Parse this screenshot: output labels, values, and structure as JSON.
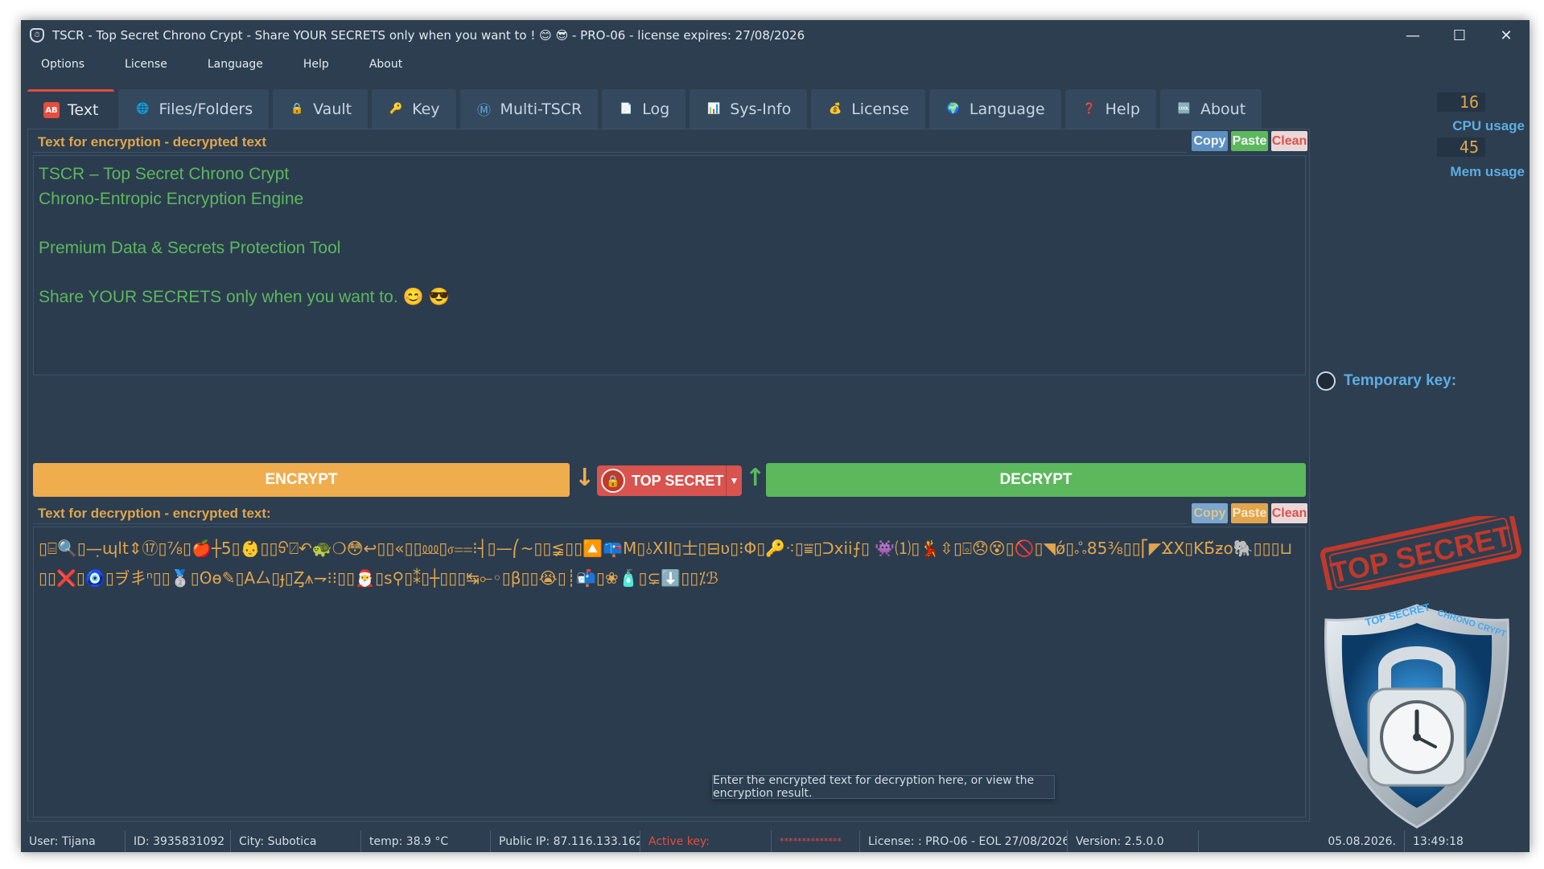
{
  "window": {
    "title": "TSCR - Top Secret Chrono Crypt - Share YOUR SECRETS only when you want to ! 😊 😎 - PRO-06 - license expires: 27/08/2026",
    "controls": {
      "minimize": "—",
      "maximize": "☐",
      "close": "✕"
    }
  },
  "menubar": [
    "Options",
    "License",
    "Language",
    "Help",
    "About"
  ],
  "tabs": [
    {
      "label": "Text",
      "icon": "text-ab-icon",
      "glyph": "AB",
      "active": true
    },
    {
      "label": "Files/Folders",
      "icon": "globe-icon",
      "glyph": "🌐"
    },
    {
      "label": "Vault",
      "icon": "vault-icon",
      "glyph": "🔒"
    },
    {
      "label": "Key",
      "icon": "key-icon",
      "glyph": "🔑"
    },
    {
      "label": "Multi-TSCR",
      "icon": "m-circle-icon",
      "glyph": "Ⓜ"
    },
    {
      "label": "Log",
      "icon": "log-icon",
      "glyph": "📄"
    },
    {
      "label": "Sys-Info",
      "icon": "chart-icon",
      "glyph": "📊"
    },
    {
      "label": "License",
      "icon": "license-icon",
      "glyph": "💰"
    },
    {
      "label": "Language",
      "icon": "language-icon",
      "glyph": "🌍"
    },
    {
      "label": "Help",
      "icon": "help-icon",
      "glyph": "❓"
    },
    {
      "label": "About",
      "icon": "about-icon",
      "glyph": "🆒"
    }
  ],
  "encrypt_section": {
    "label": "Text for encryption - decrypted text",
    "copy": "Copy",
    "paste": "Paste",
    "clean": "Clean",
    "text": "TSCR – Top Secret Chrono Crypt\nChrono-Entropic Encryption Engine\n\nPremium Data & Secrets Protection Tool\n\nShare YOUR SECRETS only when you want to. 😊 😎"
  },
  "actions": {
    "encrypt": "ENCRYPT",
    "decrypt": "DECRYPT",
    "mode": "TOP SECRET",
    "arrow_down": "↓",
    "arrow_up": "↑"
  },
  "decrypt_section": {
    "label": "Text for decryption - encrypted text:",
    "copy": "Copy",
    "paste": "Paste",
    "clean": "Clean",
    "text": "▯⌸🔍▯—़ɰlt⇕⑰▯⅞▯🍎┼5▯👶▯▯ᢒ⍁↶🐢❍😳↩▯▯«▯▯⅏▯ⳝ⩵⁝┤▯—⎛~▯▯≨▯▯🔼📪M▯⫰XII▯⼠▯⊟ʋ▯⁝Φ▯🔑⁖▯⩸▯ᑐxii⨍▯ 👾⑴▯💃⇳▯⌺😞😵▯🚫▯◥ǿ▯ஃ85⅜▯▯⎡◤ϪX▯KƂ̌ƶo🐘▯▯▯⊔▯▯❌▯🧿▯ヺ丯ⁿ▯▯🥈▯ʘɵ✎▯A⼛▯ɟ▯Ȥ⩚⇁⁝⁝▯▯🎅▯s⚲▯⁑▯┼▯▯▯↹⟜◦▯β▯▯😭▯┊📬▯❀🧴▯⊊⬇️▯▯⁒ℬ"
  },
  "tooltip": "Enter the encrypted text for decryption here, or view the encryption result.",
  "sidebar": {
    "cpu_value": "16",
    "cpu_label": "CPU usage",
    "mem_value": "45",
    "mem_label": "Mem usage",
    "temp_key_label": "Temporary key:",
    "stamp_text": "TOP SECRET",
    "shield_text_left": "TOP SECRET",
    "shield_text_right": "CHRONO CRYPT"
  },
  "statusbar": {
    "user": "User: Tijana",
    "id": "ID: 3935831092",
    "city": "City: Subotica",
    "temp": "temp: 38.9 °C",
    "ip": "Public IP: 87.116.133.162",
    "active_key": "Active key:",
    "key_mask": "**************",
    "license": "License: : PRO-06 - EOL 27/08/2026",
    "version": "Version: 2.5.0.0",
    "date": "05.08.2026.",
    "time": "13:49:18"
  },
  "colors": {
    "background": "#2c3e50",
    "accent_orange": "#f0ad4e",
    "accent_green": "#5cb85c",
    "accent_red": "#d9534f",
    "accent_blue": "#5dade2"
  }
}
